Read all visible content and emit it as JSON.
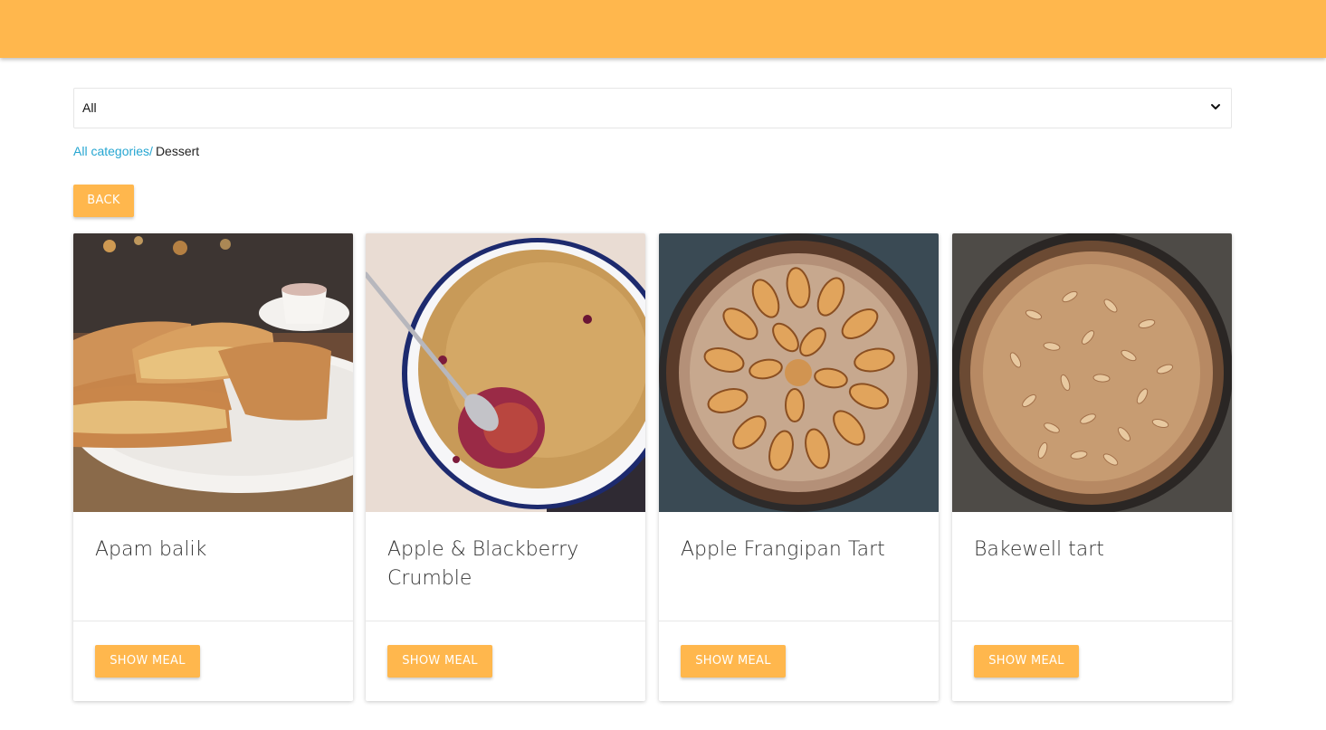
{
  "filter": {
    "selected": "All"
  },
  "breadcrumb": {
    "link": "All categories/",
    "current": "Dessert"
  },
  "back_label": "BACK",
  "meals": [
    {
      "title": "Apam balik",
      "button": "SHOW MEAL"
    },
    {
      "title": "Apple & Blackberry Crumble",
      "button": "SHOW MEAL"
    },
    {
      "title": "Apple Frangipan Tart",
      "button": "SHOW MEAL"
    },
    {
      "title": "Bakewell tart",
      "button": "SHOW MEAL"
    }
  ],
  "colors": {
    "accent": "#ffb74d",
    "link": "#26a6d1"
  }
}
